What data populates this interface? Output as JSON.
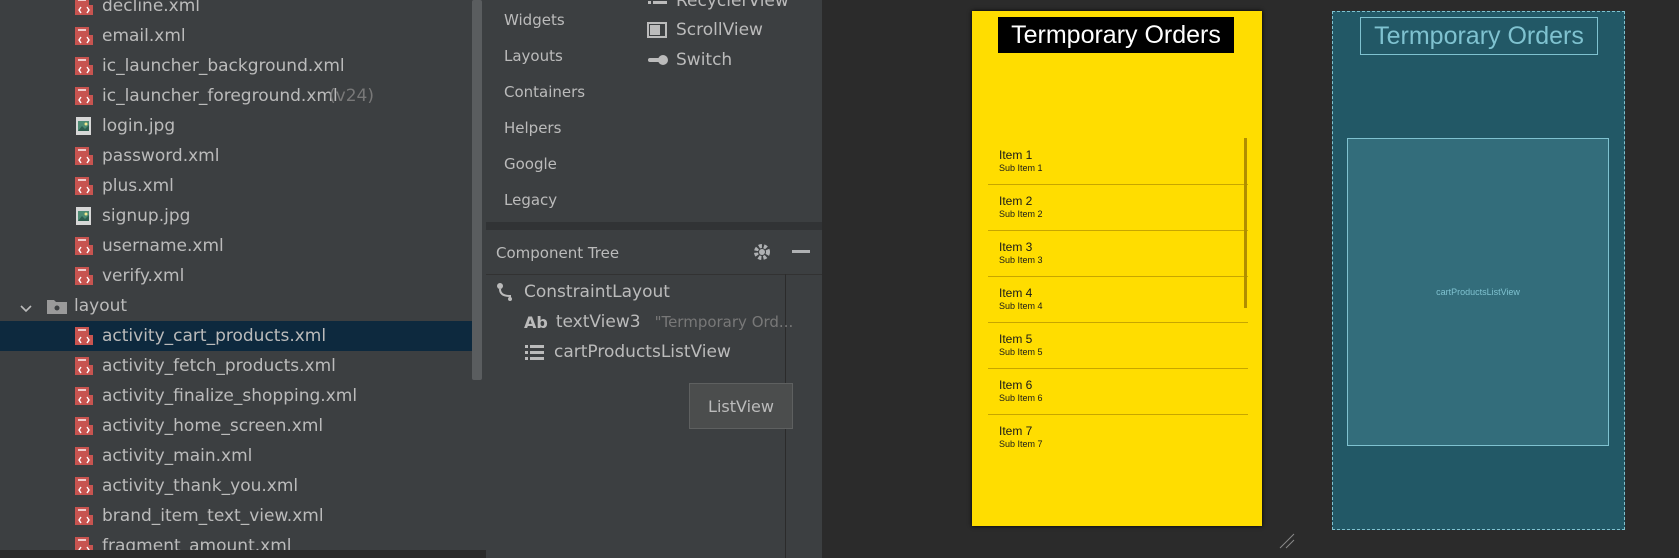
{
  "project_tree": {
    "items": [
      {
        "label": "decline.xml",
        "icon": "xml-file-icon"
      },
      {
        "label": "email.xml",
        "icon": "xml-file-icon"
      },
      {
        "label": "ic_launcher_background.xml",
        "icon": "xml-file-icon"
      },
      {
        "label": "ic_launcher_foreground.xml",
        "qualifier": "(v24)",
        "icon": "xml-file-icon"
      },
      {
        "label": "login.jpg",
        "icon": "image-file-icon"
      },
      {
        "label": "password.xml",
        "icon": "xml-file-icon"
      },
      {
        "label": "plus.xml",
        "icon": "xml-file-icon"
      },
      {
        "label": "signup.jpg",
        "icon": "image-file-icon"
      },
      {
        "label": "username.xml",
        "icon": "xml-file-icon"
      },
      {
        "label": "verify.xml",
        "icon": "xml-file-icon"
      },
      {
        "label": "layout",
        "icon": "folder-icon"
      },
      {
        "label": "activity_cart_products.xml",
        "icon": "xml-file-icon"
      },
      {
        "label": "activity_fetch_products.xml",
        "icon": "xml-file-icon"
      },
      {
        "label": "activity_finalize_shopping.xml",
        "icon": "xml-file-icon"
      },
      {
        "label": "activity_home_screen.xml",
        "icon": "xml-file-icon"
      },
      {
        "label": "activity_main.xml",
        "icon": "xml-file-icon"
      },
      {
        "label": "activity_thank_you.xml",
        "icon": "xml-file-icon"
      },
      {
        "label": "brand_item_text_view.xml",
        "icon": "xml-file-icon"
      },
      {
        "label": "fragment_amount.xml",
        "icon": "xml-file-icon"
      }
    ],
    "selected": "activity_cart_products.xml"
  },
  "palette": {
    "categories": [
      "Widgets",
      "Layouts",
      "Containers",
      "Helpers",
      "Google",
      "Legacy"
    ],
    "items": [
      {
        "label": "RecyclerView",
        "icon": "list-icon"
      },
      {
        "label": "ScrollView",
        "icon": "scrollview-icon"
      },
      {
        "label": "Switch",
        "icon": "switch-icon"
      }
    ]
  },
  "component_tree": {
    "title": "Component Tree",
    "nodes": [
      {
        "label": "ConstraintLayout",
        "icon": "constraint-layout-icon"
      },
      {
        "label": "textView3",
        "detail": "\"Termporary Ord...",
        "icon": "textview-icon"
      },
      {
        "label": "cartProductsListView",
        "icon": "list-icon"
      }
    ],
    "tooltip": "ListView",
    "textview_icon_text": "Ab"
  },
  "design_preview": {
    "title": "Termporary Orders",
    "list_items": [
      {
        "title": "Item 1",
        "sub": "Sub Item 1"
      },
      {
        "title": "Item 2",
        "sub": "Sub Item 2"
      },
      {
        "title": "Item 3",
        "sub": "Sub Item 3"
      },
      {
        "title": "Item 4",
        "sub": "Sub Item 4"
      },
      {
        "title": "Item 5",
        "sub": "Sub Item 5"
      },
      {
        "title": "Item 6",
        "sub": "Sub Item 6"
      },
      {
        "title": "Item 7",
        "sub": "Sub Item 7"
      }
    ],
    "background_color": "#ffdd00"
  },
  "blueprint": {
    "title": "Termporary Orders",
    "list_label": "cartProductsListView"
  },
  "colors": {
    "accent_selection": "#0d293e",
    "xml_icon": "#c75450",
    "blueprint_bg": "#225866",
    "blueprint_line": "#7fc2d0"
  }
}
